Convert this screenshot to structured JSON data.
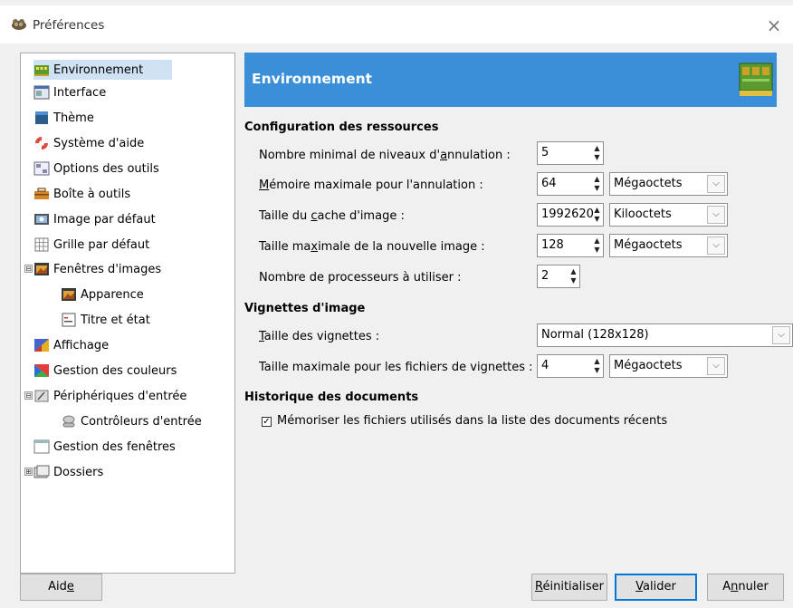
{
  "window": {
    "title": "Préférences"
  },
  "sidebar": {
    "items": [
      {
        "label": "Environnement"
      },
      {
        "label": "Interface"
      },
      {
        "label": "Thème"
      },
      {
        "label": "Système d'aide"
      },
      {
        "label": "Options des outils"
      },
      {
        "label": "Boîte à outils"
      },
      {
        "label": "Image par défaut"
      },
      {
        "label": "Grille par défaut"
      },
      {
        "label": "Fenêtres d'images"
      },
      {
        "label": "Apparence"
      },
      {
        "label": "Titre et état"
      },
      {
        "label": "Affichage"
      },
      {
        "label": "Gestion des couleurs"
      },
      {
        "label": "Périphériques d'entrée"
      },
      {
        "label": "Contrôleurs d'entrée"
      },
      {
        "label": "Gestion des fenêtres"
      },
      {
        "label": "Dossiers"
      }
    ],
    "selected": "Environnement",
    "expanders": {
      "fenetres": "⊟",
      "peripheriques": "⊟",
      "dossiers": "⊞"
    }
  },
  "banner": {
    "title": "Environnement",
    "color": "#3a8fd8"
  },
  "resources": {
    "section_title": "Configuration des ressources",
    "undo_levels": {
      "label_a": "Nombre minimal de niveaux d'",
      "label_u": "a",
      "label_b": "nnulation :",
      "value": "5"
    },
    "undo_memory": {
      "label_u": "M",
      "label_b": "émoire maximale pour l'annulation :",
      "value": "64",
      "unit": "Mégaoctets"
    },
    "tile_cache": {
      "label_a": "Taille du ",
      "label_u": "c",
      "label_b": "ache d'image :",
      "value": "1992620",
      "unit": "Kilooctets"
    },
    "max_image": {
      "label_a": "Taille ma",
      "label_u": "x",
      "label_b": "imale de la nouvelle image :",
      "value": "128",
      "unit": "Mégaoctets"
    },
    "processors": {
      "label": "Nombre de processeurs à utiliser :",
      "value": "2"
    }
  },
  "thumbnails": {
    "section_title": "Vignettes d'image",
    "size": {
      "label_u": "T",
      "label_b": "aille des vignettes :",
      "value": "Normal (128x128)"
    },
    "max_file": {
      "label": "Taille maximale pour les fichiers de vignettes :",
      "value": "4",
      "unit": "Mégaoctets"
    }
  },
  "history": {
    "section_title": "Historique des documents",
    "remember": {
      "label": "Mémoriser les fichiers utilisés dans la liste des documents récents",
      "checked": true,
      "mark": "✓"
    }
  },
  "buttons": {
    "help": {
      "label_a": "Aid",
      "label_u": "e"
    },
    "reset": {
      "label_u": "R",
      "label_b": "éinitialiser"
    },
    "ok": {
      "label_u": "V",
      "label_b": "alider"
    },
    "cancel": {
      "label_a": "A",
      "label_u": "n",
      "label_b": "nuler"
    }
  },
  "glyphs": {
    "close": "×",
    "spin_up": "▲",
    "spin_down": "▼",
    "dropdown": "⌵"
  }
}
